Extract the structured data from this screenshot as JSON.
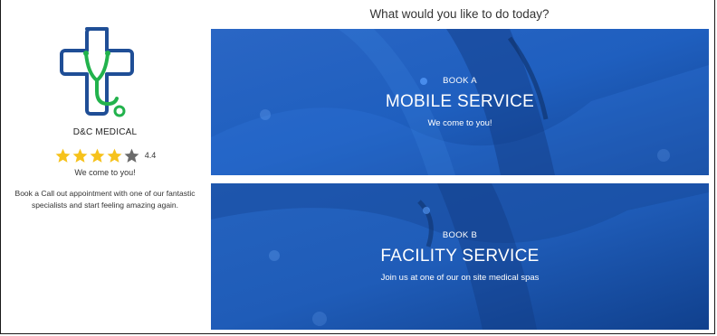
{
  "page": {
    "heading": "What would you like to do today?"
  },
  "sidebar": {
    "brand_name": "D&C MEDICAL",
    "rating": {
      "value": "4.4",
      "stars_filled": 4,
      "stars_total": 5
    },
    "tagline": "We come to you!",
    "description": "Book a Call out appointment with one of our fantastic specialists and start feeling amazing again."
  },
  "cards": [
    {
      "small": "BOOK A",
      "title": "MOBILE SERVICE",
      "subtitle": "We come to you!"
    },
    {
      "small": "BOOK B",
      "title": "FACILITY SERVICE",
      "subtitle": "Join us at one of our on site medical spas"
    }
  ],
  "colors": {
    "logo_blue": "#1f4e96",
    "logo_green": "#22b24c",
    "star_gold": "#f6c21c",
    "star_empty": "#6b6b6b",
    "card_blue": "#1f5fbf"
  }
}
